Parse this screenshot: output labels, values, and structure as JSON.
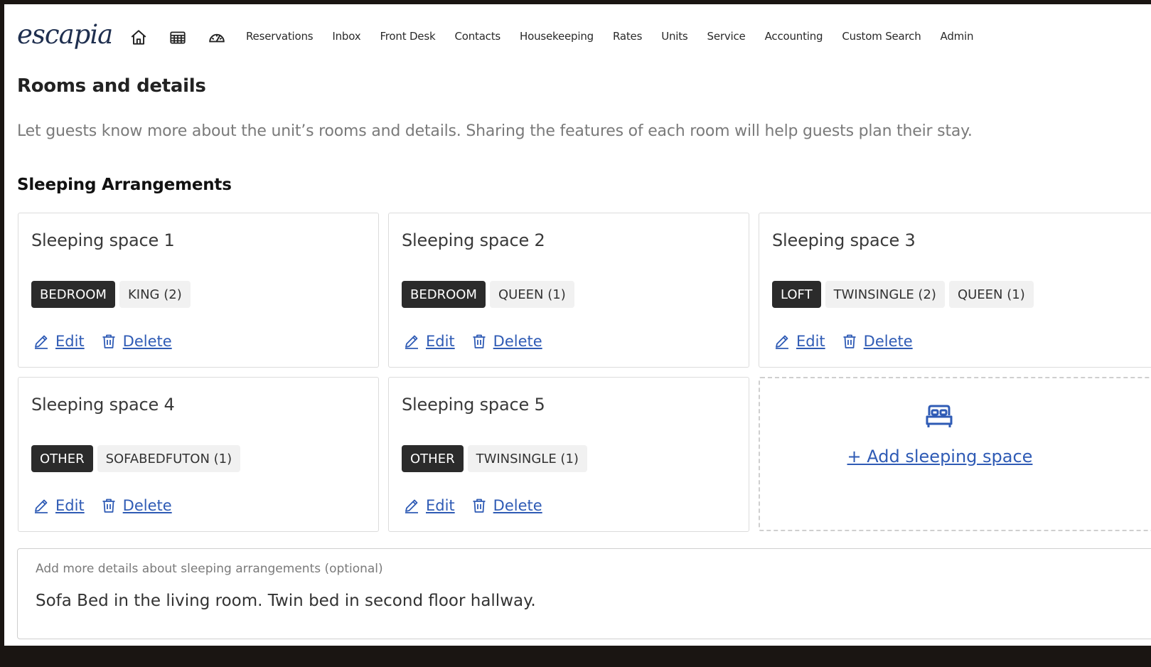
{
  "header": {
    "logo": "escapia",
    "nav": [
      "Reservations",
      "Inbox",
      "Front Desk",
      "Contacts",
      "Housekeeping",
      "Rates",
      "Units",
      "Service",
      "Accounting",
      "Custom Search",
      "Admin"
    ]
  },
  "page": {
    "title": "Rooms and details",
    "description": "Let guests know more about the unit’s rooms and details. Sharing the features of each room will help guests plan their stay.",
    "section_title": "Sleeping Arrangements"
  },
  "actions": {
    "edit": "Edit",
    "delete": "Delete"
  },
  "spaces": [
    {
      "title": "Sleeping space 1",
      "type": "BEDROOM",
      "beds": [
        "KING (2)"
      ]
    },
    {
      "title": "Sleeping space 2",
      "type": "BEDROOM",
      "beds": [
        "QUEEN (1)"
      ]
    },
    {
      "title": "Sleeping space 3",
      "type": "LOFT",
      "beds": [
        "TWINSINGLE (2)",
        "QUEEN (1)"
      ]
    },
    {
      "title": "Sleeping space 4",
      "type": "OTHER",
      "beds": [
        "SOFABEDFUTON (1)"
      ]
    },
    {
      "title": "Sleeping space 5",
      "type": "OTHER",
      "beds": [
        "TWINSINGLE (1)"
      ]
    }
  ],
  "add_space": {
    "label": "+ Add sleeping space"
  },
  "details": {
    "label": "Add more details about sleeping arrangements (optional)",
    "value": "Sofa Bed in the living room. Twin bed in second floor hallway."
  },
  "colors": {
    "link": "#2f5bb5",
    "chip_dark": "#2b2b2b",
    "chip_light": "#f1f1f1"
  }
}
